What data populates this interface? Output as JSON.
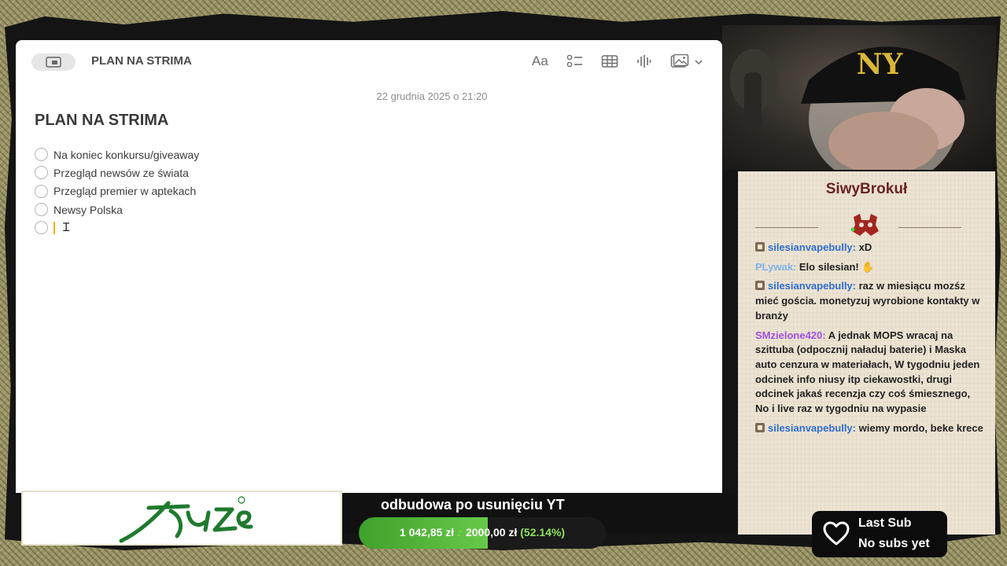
{
  "notes": {
    "window_title": "PLAN NA STRIMA",
    "date": "22 grudnia 2025 o 21:20",
    "note_title": "PLAN NA STRIMA",
    "format_button_label": "Aa",
    "checklist": [
      "Na koniec konkursu/giveaway",
      "Przegląd newsów ze świata",
      "Przegląd premier w aptekach",
      "Newsy Polska",
      ""
    ],
    "icons": [
      "sidebar-icon",
      "format-icon",
      "checklist-icon",
      "table-icon",
      "audio-icon",
      "media-icon",
      "chevron-down-icon"
    ]
  },
  "chat": {
    "channel_name": "SiwyBrokuł",
    "messages": [
      {
        "user": "silesianvapebully",
        "color": "#2f6fcf",
        "badge": true,
        "text": "xD"
      },
      {
        "user": "PLywak",
        "color": "#7fb3e8",
        "badge": false,
        "text": "Elo silesian! ✋"
      },
      {
        "user": "silesianvapebully",
        "color": "#2f6fcf",
        "badge": true,
        "text": "raz w miesiącu mozśz mieć gościa. monetyzuj wyrobione kontakty w branży"
      },
      {
        "user": "SMzielone420",
        "color": "#a24fe0",
        "badge": false,
        "text": "A jednak MOPS wracaj na szittuba (odpocznij naładuj baterie) i Maska auto cenzura w materiałach, W tygodniu jeden odcinek info niusy itp ciekawostki, drugi odcinek jakaś recenzja czy coś śmiesznego, No i live raz w tygodniu na wypasie"
      },
      {
        "user": "silesianvapebully",
        "color": "#2f6fcf",
        "badge": true,
        "text": "wiemy mordo, beke krece"
      }
    ]
  },
  "goal": {
    "title": "odbudowa po usunięciu YT",
    "current": "1 042,85 zł",
    "separator": "z",
    "target": "2000,00 zł",
    "percent_label": "(52.14%)",
    "progress": 0.5214
  },
  "last_sub": {
    "title": "Last Sub",
    "value": "No subs yet"
  },
  "colors": {
    "goal_fill": "#4fb335",
    "chat_header": "#6a2320",
    "caret": "#f0b400",
    "logo_green": "#1f7a2e"
  }
}
